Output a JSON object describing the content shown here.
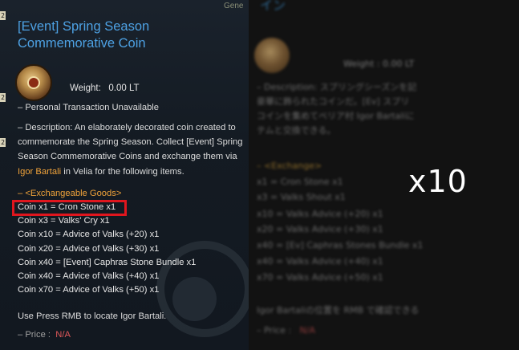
{
  "tooltip": {
    "ghost_tab": "Gene",
    "edge_numbers": [
      "2",
      "2",
      "2"
    ],
    "title": "[Event] Spring Season Commemorative Coin",
    "weight_label": "Weight:",
    "weight_value": "0.00 LT",
    "personal": "– Personal Transaction Unavailable",
    "desc_prefix": "– Description: An elaborately decorated coin created to commemorate the Spring Season. Collect [Event] Spring Season Commemorative Coins and exchange them via ",
    "desc_npc": "Igor Bartali",
    "desc_suffix": " in Velia for the following items.",
    "exchange_header": "– <Exchangeable Goods>",
    "exchange_items": [
      "Coin x1 = Cron Stone x1",
      "Coin x3 = Valks' Cry x1",
      "Coin x10 = Advice of Valks (+20) x1",
      "Coin x20 = Advice of Valks (+30) x1",
      "Coin x40 = [Event] Caphras Stone Bundle x1",
      "Coin x40 = Advice of Valks (+40) x1",
      "Coin x70 = Advice of Valks (+50) x1"
    ],
    "hint": "Use Press RMB to locate Igor Bartali.",
    "price_label": "– Price :",
    "price_value": "N/A"
  },
  "jp_panel": {
    "title": "イン",
    "weight": "Weight : 0.00 LT",
    "desc_lines": [
      "– Description: スプリングシーズンを記",
      "豪華に飾られたコインだ。[Ev] スプリ",
      "コインを集めてベリア村 Igor Bartaliに",
      "テムと交換できる。"
    ],
    "exchange_header": "– <Exchange>",
    "exchange_items": [
      "x1 = Cron Stone x1",
      "x3 = Valks Shout x1",
      "x10 = Valks Advice (+20) x1",
      "x20 = Valks Advice (+30) x1",
      "x40 = [Ev] Caphras Stones Bundle x1",
      "x40 = Valks Advice (+40) x1",
      "x70 = Valks Advice (+50) x1"
    ],
    "hint": "Igor Bartaliの位置を RMB で確認できる",
    "price_label": "– Price :",
    "price_value": "N/A"
  },
  "overlay": {
    "multiplier_label": "x10"
  },
  "colors": {
    "title_blue": "#4da1e3",
    "npc_orange": "#f0a23a",
    "highlight_red": "#e0161e",
    "price_red": "#e0585a"
  }
}
